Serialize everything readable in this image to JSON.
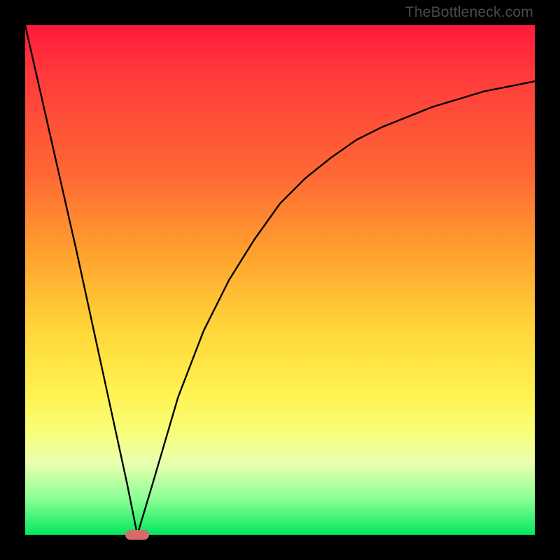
{
  "watermark": "TheBottleneck.com",
  "colors": {
    "marker": "#d96a6a",
    "curve": "#000000",
    "frame": "#000000"
  },
  "chart_data": {
    "type": "line",
    "title": "",
    "xlabel": "",
    "ylabel": "",
    "xlim": [
      0,
      100
    ],
    "ylim": [
      0,
      100
    ],
    "grid": false,
    "legend": false,
    "series": [
      {
        "name": "bottleneck-curve",
        "x": [
          0,
          5,
          10,
          15,
          20,
          22,
          25,
          30,
          35,
          40,
          45,
          50,
          55,
          60,
          65,
          70,
          75,
          80,
          85,
          90,
          95,
          100
        ],
        "y": [
          100,
          78,
          56,
          33,
          10,
          0,
          10,
          27,
          40,
          50,
          58,
          65,
          70,
          74,
          77.5,
          80,
          82,
          84,
          85.5,
          87,
          88,
          89
        ]
      }
    ],
    "marker": {
      "x": 22,
      "y": 0
    },
    "gradient_meaning": "top (red) = high bottleneck, bottom (green) = no bottleneck"
  }
}
